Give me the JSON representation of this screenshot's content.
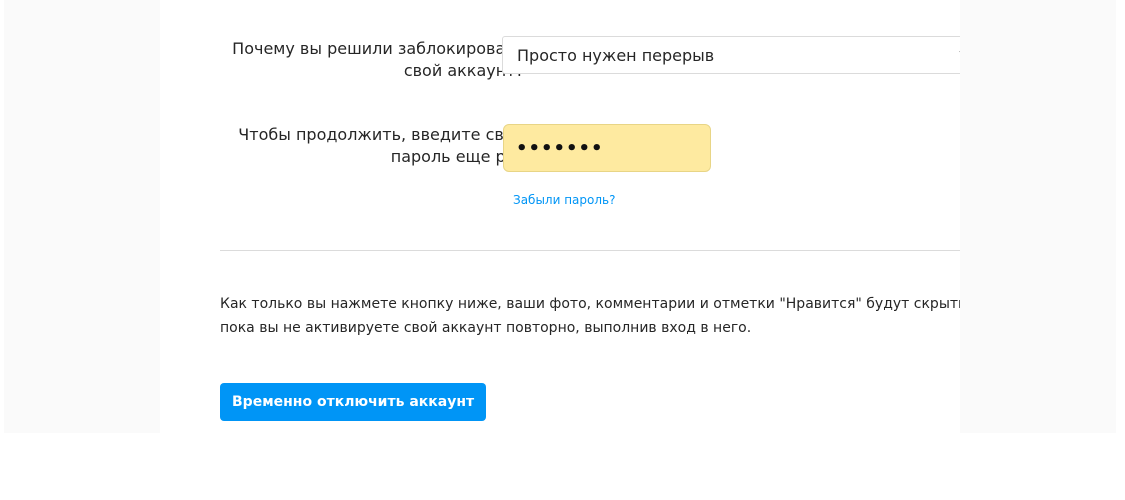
{
  "form": {
    "reason_label": "Почему вы решили заблокировать свой аккаунт?",
    "reason_value": "Просто нужен перерыв",
    "password_label": "Чтобы продолжить, введите свой пароль еще раз",
    "password_masked": "•••••••",
    "forgot_password_link": "Забыли пароль?"
  },
  "notice": {
    "text": "Как только вы нажмете кнопку ниже, ваши фото, комментарии и отметки \"Нравится\" будут скрыты, пока вы не активируете свой аккаунт повторно, выполнив вход в него."
  },
  "actions": {
    "deactivate_label": "Временно отключить аккаунт"
  },
  "colors": {
    "accent": "#0095f6",
    "autofill_bg": "#feeaa0",
    "border": "#dbdbdb",
    "text": "#262626"
  }
}
